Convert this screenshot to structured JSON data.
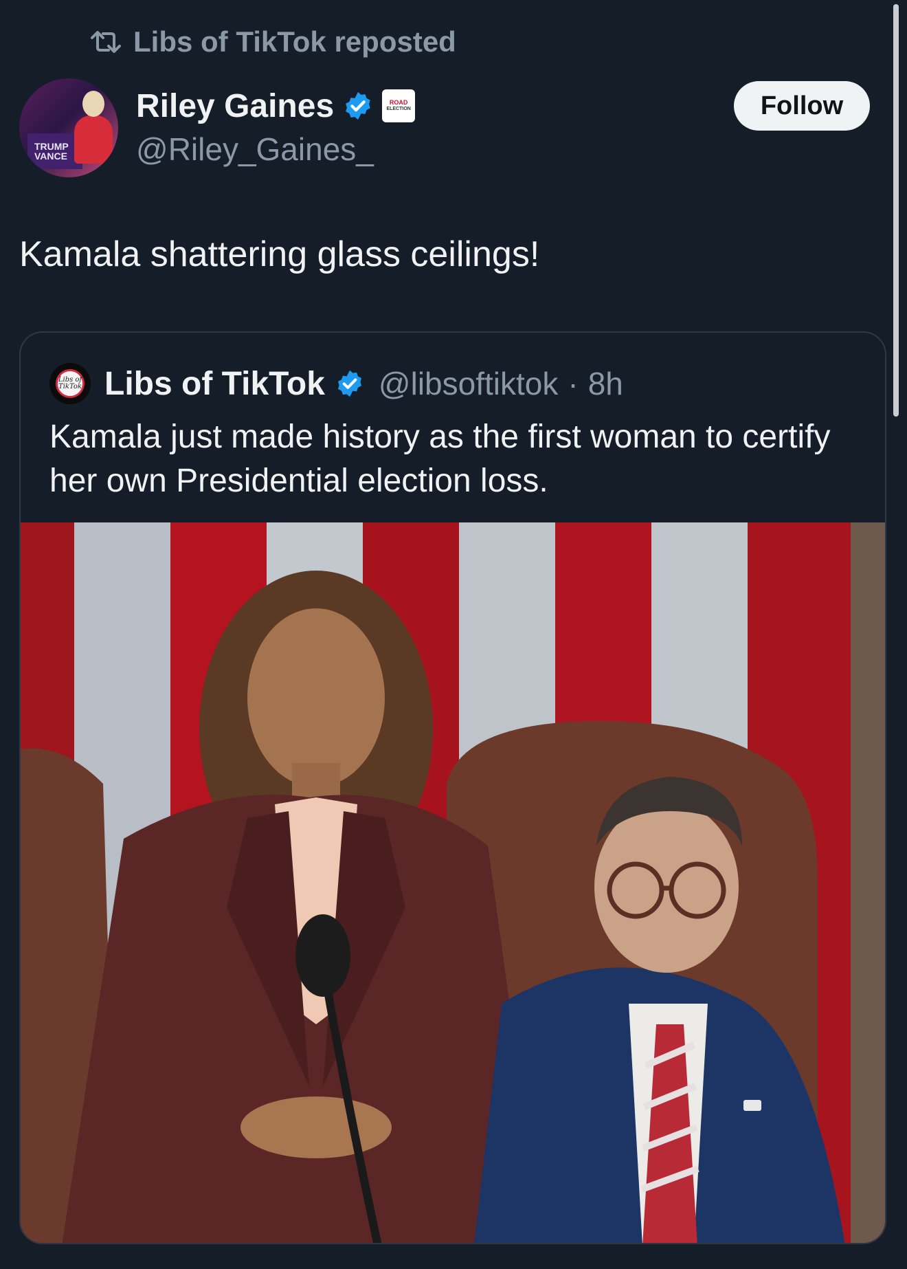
{
  "repost": {
    "icon": "repost-icon",
    "text": "Libs of TikTok reposted"
  },
  "author": {
    "name": "Riley Gaines",
    "handle": "@Riley_Gaines_",
    "verified": true,
    "badge_line1": "ROAD",
    "badge_line2": "ELECTION",
    "avatar_sign": "TRUMP\nVANCE"
  },
  "follow_button": {
    "label": "Follow"
  },
  "post": {
    "text": "Kamala shattering glass ceilings!"
  },
  "quoted": {
    "avatar_line1": "Libs of",
    "avatar_line2": "TikTok",
    "name": "Libs of TikTok",
    "handle": "@libsoftiktok",
    "separator": "·",
    "time": "8h",
    "text": "Kamala just made history as the first woman to certify her own Presidential election loss."
  },
  "colors": {
    "background": "#151d28",
    "verified_blue": "#1d9bf0",
    "secondary_text": "#8b98a5",
    "follow_bg": "#eff3f4"
  }
}
